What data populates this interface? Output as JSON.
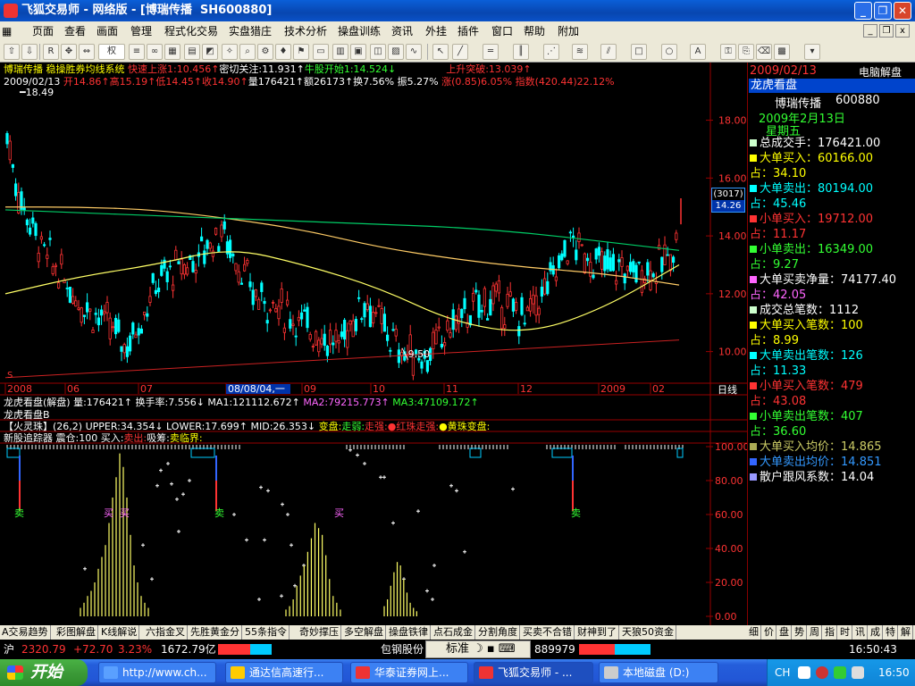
{
  "window": {
    "title": "飞狐交易师 - 网络版 - [博瑞传播  SH600880]",
    "controls": {
      "minimize": "_",
      "restore": "❐",
      "close": "✕"
    },
    "mdi_controls": {
      "minimize": "_",
      "restore": "❐",
      "close": "x"
    }
  },
  "menu": [
    "页面",
    "查看",
    "画面",
    "管理",
    "程式化交易",
    "实盘猎庄",
    "技术分析",
    "操盘训练",
    "资讯",
    "外挂",
    "插件",
    "窗口",
    "帮助",
    "附加"
  ],
  "toolbar": {
    "period_select": "权"
  },
  "main_chart": {
    "header_line1": [
      {
        "text": "博瑞传播 稳操胜券均线系统 ",
        "color": "#ffff00"
      },
      {
        "text": "快速上涨1:10.456↑",
        "color": "#ff3333"
      },
      {
        "text": "密切关注:11.931↑",
        "color": "#ffffff"
      },
      {
        "text": "牛股开始1:14.524↓",
        "color": "#33ff33"
      },
      {
        "text": "                上升突破:13.039↑",
        "color": "#ff3333"
      }
    ],
    "header_line2": [
      {
        "text": "2009/02/13 ",
        "color": "#ffffff"
      },
      {
        "text": "开14.86↑高15.19↑低14.45↑收14.90↑",
        "color": "#ff3333"
      },
      {
        "text": "量176421↑额26173↑换7.56%",
        "color": "#ffffff"
      },
      {
        "text": " 振5.27%",
        "color": "#ffffff"
      },
      {
        "text": " 涨(0.85)6.05%",
        "color": "#ff3333"
      },
      {
        "text": " 指数(420.44)22.12%",
        "color": "#ff3333"
      }
    ],
    "high_label": "18.49",
    "low_label": "9.50",
    "price_box": [
      "(3017)",
      "14.26"
    ],
    "y_axis": [
      "18.00",
      "16.00",
      "14.00",
      "12.00",
      "10.00"
    ],
    "corner_label": "S",
    "x_axis": [
      "2008",
      "06",
      "07",
      "08/08/04,一",
      "09",
      "10",
      "11",
      "12",
      "2009",
      "02"
    ],
    "x_axis_right": "日线"
  },
  "chart_data": [
    {
      "type": "line",
      "title": "博瑞传播 稳操胜券均线系统",
      "x": [
        "2008",
        "06",
        "07",
        "08",
        "09",
        "10",
        "11",
        "12",
        "2009",
        "02"
      ],
      "ylim": [
        9.0,
        19.5
      ],
      "series": [
        {
          "name": "快速上涨1",
          "values": [
            12.0,
            12.6,
            13.0,
            13.6,
            13.0,
            12.2,
            11.0,
            10.6,
            11.5,
            13.0
          ]
        },
        {
          "name": "上升突破",
          "values": [
            15.0,
            15.0,
            14.9,
            14.6,
            14.2,
            13.6,
            13.2,
            12.9,
            12.7,
            12.3
          ]
        },
        {
          "name": "牛股开始1",
          "values": [
            14.9,
            14.8,
            14.7,
            14.6,
            14.5,
            14.4,
            14.3,
            14.1,
            13.8,
            13.5
          ]
        }
      ]
    },
    {
      "type": "line",
      "title": "新股追踪器",
      "ylim": [
        0,
        100
      ],
      "yticks": [
        "100.00",
        "80.00",
        "60.00",
        "40.00",
        "20.00",
        "0.00"
      ]
    }
  ],
  "indicator_header": {
    "line1": [
      {
        "text": "龙虎看盘(解盘) ",
        "color": "#ffffff"
      },
      {
        "text": "量:176421↑",
        "color": "#ffffff"
      },
      {
        "text": " 换手率:7.556↓",
        "color": "#ffffff"
      },
      {
        "text": " MA1:121112.672↑",
        "color": "#ffffff"
      },
      {
        "text": " MA2:79215.773↑",
        "color": "#ff66ff"
      },
      {
        "text": " MA3:47109.172↑",
        "color": "#33ff33"
      }
    ],
    "line2": "龙虎看盘B",
    "line3": [
      {
        "text": "【火灵珠】(26,2) UPPER:34.354↓ LOWER:17.699↑ MID:26.353↓ ",
        "color": "#ffffff"
      },
      {
        "text": "变盘:",
        "color": "#ffff00"
      },
      {
        "text": "走弱:",
        "color": "#33ff33"
      },
      {
        "text": "走强:",
        "color": "#ff3333"
      },
      {
        "text": "●红珠走强:",
        "color": "#ff3333"
      },
      {
        "text": "●黄珠变盘:",
        "color": "#ffff00"
      }
    ],
    "line4": [
      {
        "text": "新股追踪器 震仓:100 ",
        "color": "#ffffff"
      },
      {
        "text": "买入:",
        "color": "#ffffff"
      },
      {
        "text": "卖出:",
        "color": "#ff3333"
      },
      {
        "text": "吸筹:",
        "color": "#ffffff"
      },
      {
        "text": "卖临界:",
        "color": "#ffff00"
      }
    ],
    "signals": [
      "卖",
      "买",
      "买",
      "卖",
      "买",
      "卖"
    ]
  },
  "right_panel": {
    "date": "2009/02/13",
    "button": "电脑解盘",
    "section_title": "龙虎看盘",
    "stock_name": "博瑞传播",
    "stock_code": "600880",
    "date_cn": "2009年2月13日",
    "weekday": "星期五",
    "rows": [
      {
        "label": "总成交手：",
        "value": "176421.00",
        "color": "#ffffff",
        "sq": "#ccffcc"
      },
      {
        "label": "大单买入：",
        "value": "60166.00",
        "color": "#ffff00",
        "sq": "#ffff00"
      },
      {
        "label": "占：",
        "value": "34.10",
        "color": "#ffff00",
        "sq": ""
      },
      {
        "label": "大单卖出：",
        "value": "80194.00",
        "color": "#00ffff",
        "sq": "#00ffff"
      },
      {
        "label": "占：",
        "value": "45.46",
        "color": "#00ffff",
        "sq": ""
      },
      {
        "label": "小单买入：",
        "value": "19712.00",
        "color": "#ff3333",
        "sq": "#ff3333"
      },
      {
        "label": "占：",
        "value": "11.17",
        "color": "#ff3333",
        "sq": ""
      },
      {
        "label": "小单卖出：",
        "value": "16349.00",
        "color": "#33ff33",
        "sq": "#33ff33"
      },
      {
        "label": "占：",
        "value": "9.27",
        "color": "#33ff33",
        "sq": ""
      },
      {
        "label": "大单买卖净量：",
        "value": "74177.40",
        "color": "#ffffff",
        "sq": "#ff66ff"
      },
      {
        "label": "占：",
        "value": "42.05",
        "color": "#ff66ff",
        "sq": ""
      },
      {
        "label": "成交总笔数：",
        "value": "1112",
        "color": "#ffffff",
        "sq": "#ccffcc"
      },
      {
        "label": "大单买入笔数：",
        "value": "100",
        "color": "#ffff00",
        "sq": "#ffff00"
      },
      {
        "label": "占：",
        "value": "8.99",
        "color": "#ffff00",
        "sq": ""
      },
      {
        "label": "大单卖出笔数：",
        "value": "126",
        "color": "#00ffff",
        "sq": "#00ffff"
      },
      {
        "label": "占：",
        "value": "11.33",
        "color": "#00ffff",
        "sq": ""
      },
      {
        "label": "小单买入笔数：",
        "value": "479",
        "color": "#ff3333",
        "sq": "#ff3333"
      },
      {
        "label": "占：",
        "value": "43.08",
        "color": "#ff3333",
        "sq": ""
      },
      {
        "label": "小单卖出笔数：",
        "value": "407",
        "color": "#33ff33",
        "sq": "#33ff33"
      },
      {
        "label": "占：",
        "value": "36.60",
        "color": "#33ff33",
        "sq": ""
      },
      {
        "label": "大单买入均价：",
        "value": "14.865",
        "color": "#cccc66",
        "sq": "#aaaa55"
      },
      {
        "label": "大单卖出均价：",
        "value": "14.851",
        "color": "#3399ff",
        "sq": "#3366ff"
      },
      {
        "label": "散户跟风系数：",
        "value": "14.04",
        "color": "#ffffff",
        "sq": "#9999ff"
      }
    ]
  },
  "bottom_tabs": [
    "A交易趋势",
    "彩图解盘",
    "K线解说",
    "六指金叉",
    "先胜黄金分",
    "55条指令",
    "奇妙撑压",
    "多空解盘",
    "操盘铁律",
    "点石成金",
    "分割角度",
    "买卖不合错",
    "财神到了",
    "天狼50资金"
  ],
  "bottom_right_tabs": [
    "细",
    "价",
    "盘",
    "势",
    "周",
    "指",
    "时",
    "讯",
    "成",
    "特",
    "解"
  ],
  "status": {
    "market": "沪",
    "index": "2320.79",
    "change": "+72.70",
    "percent": "3.23%",
    "amount": "1672.79亿",
    "ticker_name": "包钢股份",
    "ime_label": "标准",
    "ticker_value": "889979",
    "time": "16:50:43"
  },
  "taskbar": {
    "start": "开始",
    "tasks": [
      "http://www.ch...",
      "通达信高速行...",
      "华泰证券网上...",
      "飞狐交易师 - ...",
      "本地磁盘 (D:)"
    ],
    "lang": "CH",
    "clock": "16:50"
  }
}
